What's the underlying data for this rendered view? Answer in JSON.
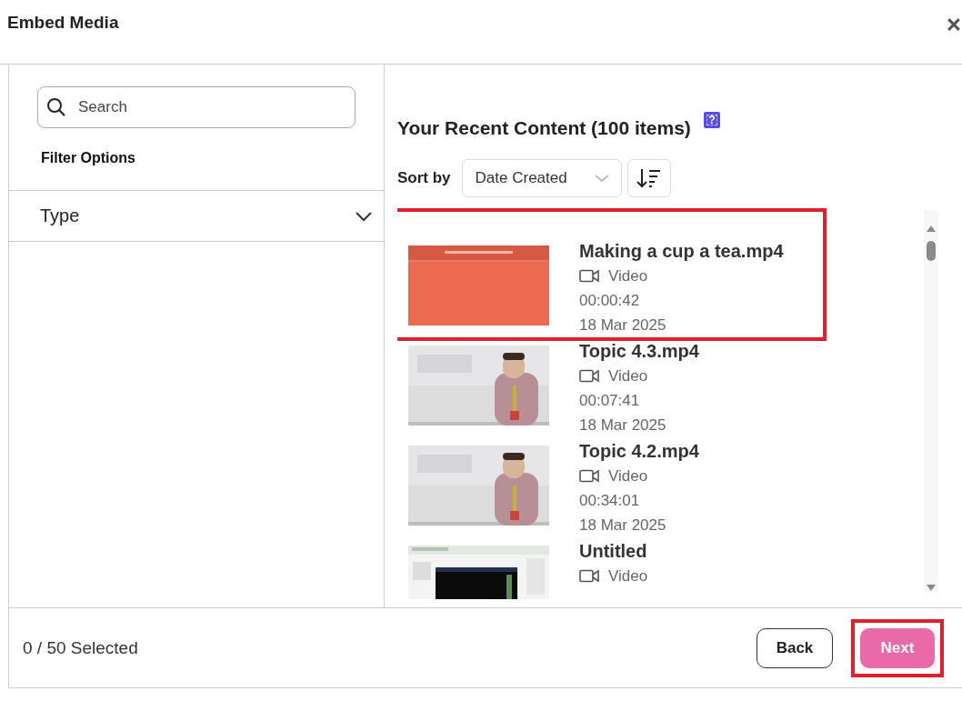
{
  "window": {
    "title": "Embed Media"
  },
  "sidebar": {
    "search": {
      "placeholder": "Search"
    },
    "filter_heading": "Filter Options",
    "filters": [
      {
        "label": "Type",
        "expanded": false
      }
    ]
  },
  "content": {
    "heading": "Your Recent Content (100 items)",
    "help_icon": "?",
    "sort_label": "Sort by",
    "sort_value": "Date Created",
    "items": [
      {
        "title": "Making a cup a tea.mp4",
        "type": "Video",
        "duration": "00:00:42",
        "date": "18 Mar 2025",
        "highlighted": true
      },
      {
        "title": "Topic 4.3.mp4",
        "type": "Video",
        "duration": "00:07:41",
        "date": "18 Mar 2025",
        "highlighted": false
      },
      {
        "title": "Topic 4.2.mp4",
        "type": "Video",
        "duration": "00:34:01",
        "date": "18 Mar 2025",
        "highlighted": false
      },
      {
        "title": "Untitled",
        "type": "Video",
        "highlighted": false
      }
    ]
  },
  "footer": {
    "selected_count": "0 / 50 Selected",
    "buttons": [
      {
        "label": "Back",
        "kind": "secondary",
        "highlighted": false
      },
      {
        "label": "Next",
        "kind": "primary",
        "highlighted": true
      }
    ]
  }
}
